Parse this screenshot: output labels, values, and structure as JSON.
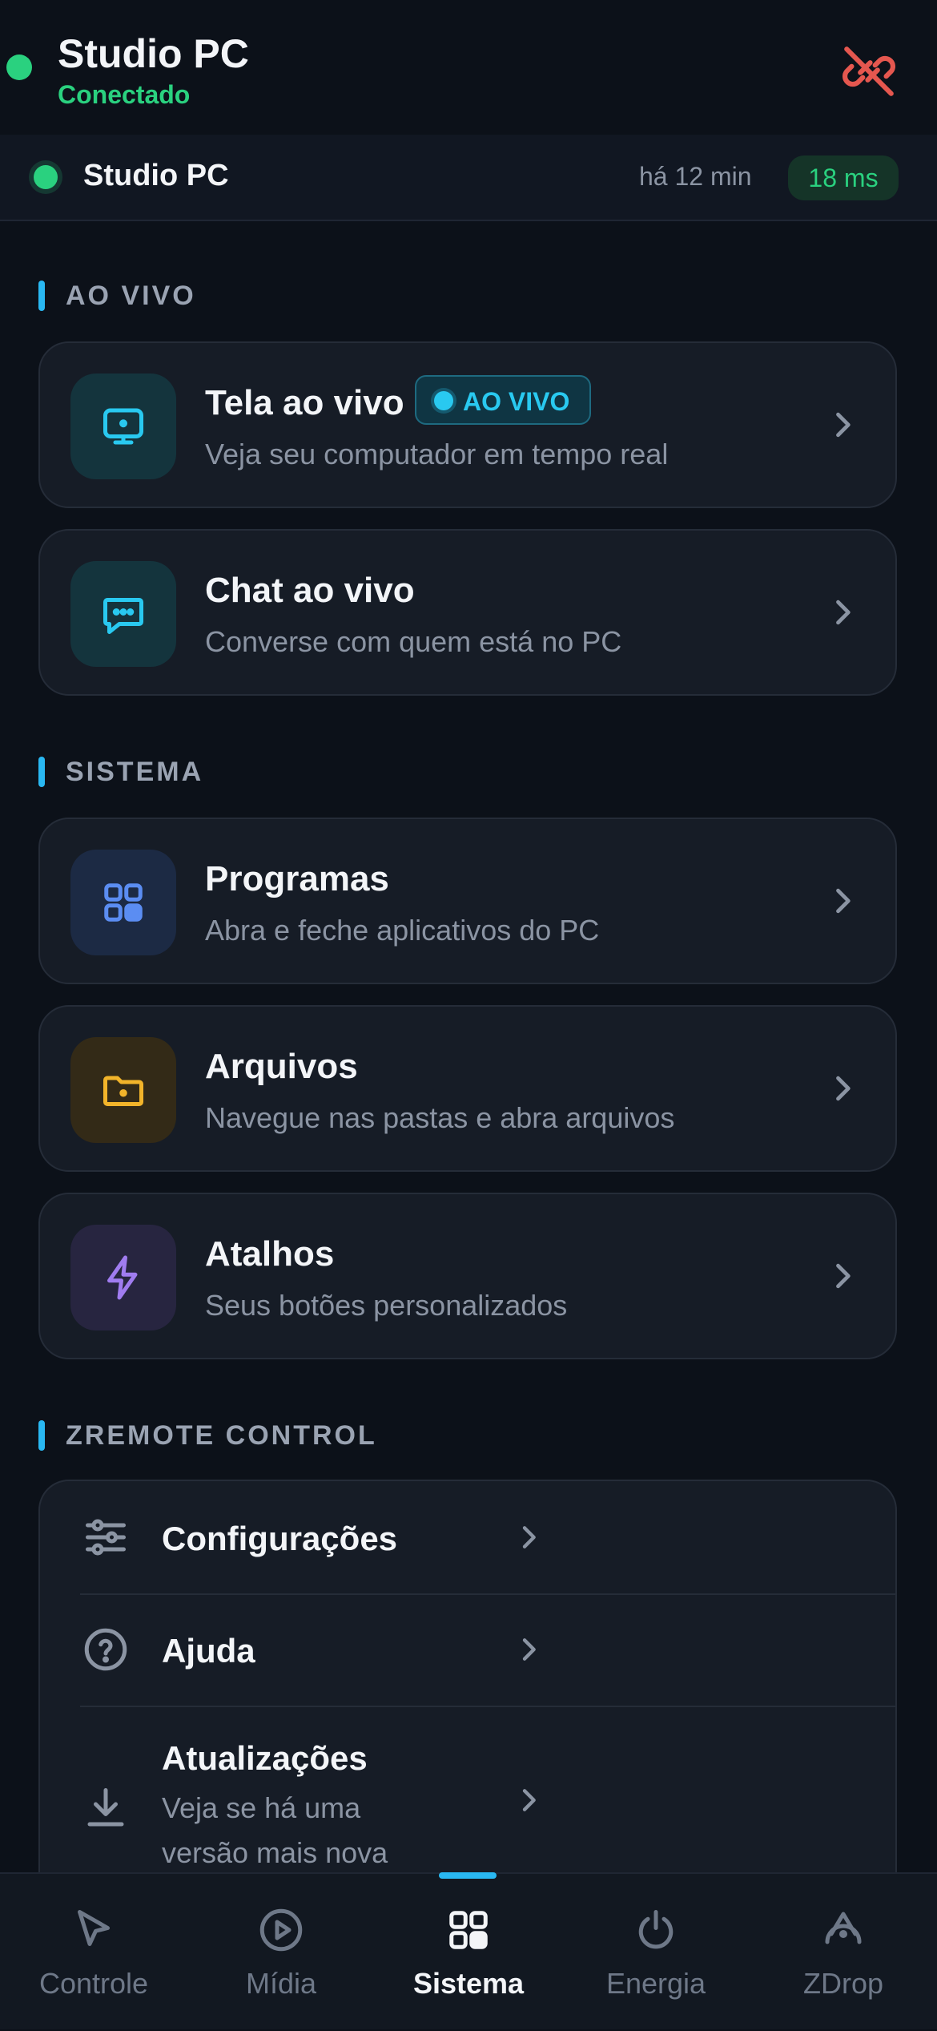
{
  "header": {
    "device_name": "Studio PC",
    "status": "Conectado",
    "disconnect_icon": "link-off-icon"
  },
  "device_bar": {
    "name": "Studio PC",
    "last_seen": "há 12 min",
    "latency": "18 ms"
  },
  "sections": {
    "live": "AO VIVO",
    "system": "SISTEMA",
    "app": "ZREMOTE CONTROL"
  },
  "live_cards": [
    {
      "title": "Tela ao vivo",
      "subtitle": "Veja seu computador em tempo real",
      "badge": "AO VIVO",
      "icon": "monitor-icon"
    },
    {
      "title": "Chat ao vivo",
      "subtitle": "Converse com quem está no PC",
      "icon": "chat-icon"
    }
  ],
  "system_cards": [
    {
      "title": "Programas",
      "subtitle": "Abra e feche aplicativos do PC",
      "icon": "apps-grid-icon"
    },
    {
      "title": "Arquivos",
      "subtitle": "Navegue nas pastas e abra arquivos",
      "icon": "folder-icon"
    },
    {
      "title": "Atalhos",
      "subtitle": "Seus botões personalizados",
      "icon": "lightning-icon"
    }
  ],
  "app_list": [
    {
      "title": "Configurações",
      "icon": "sliders-icon"
    },
    {
      "title": "Ajuda",
      "icon": "help-circle-icon"
    },
    {
      "title": "Atualizações",
      "subtitle": "Veja se há uma versão mais nova",
      "icon": "download-icon"
    }
  ],
  "nav": [
    {
      "label": "Controle",
      "icon": "cursor-icon",
      "active": false
    },
    {
      "label": "Mídia",
      "icon": "play-circle-icon",
      "active": false
    },
    {
      "label": "Sistema",
      "icon": "grid-icon",
      "active": true
    },
    {
      "label": "Energia",
      "icon": "power-icon",
      "active": false
    },
    {
      "label": "ZDrop",
      "icon": "airdrop-icon",
      "active": false
    }
  ],
  "colors": {
    "background": "#0c1119",
    "card": "#161c26",
    "accent": "#29b8f2",
    "online": "#2ad17f",
    "danger": "#e5574f"
  }
}
